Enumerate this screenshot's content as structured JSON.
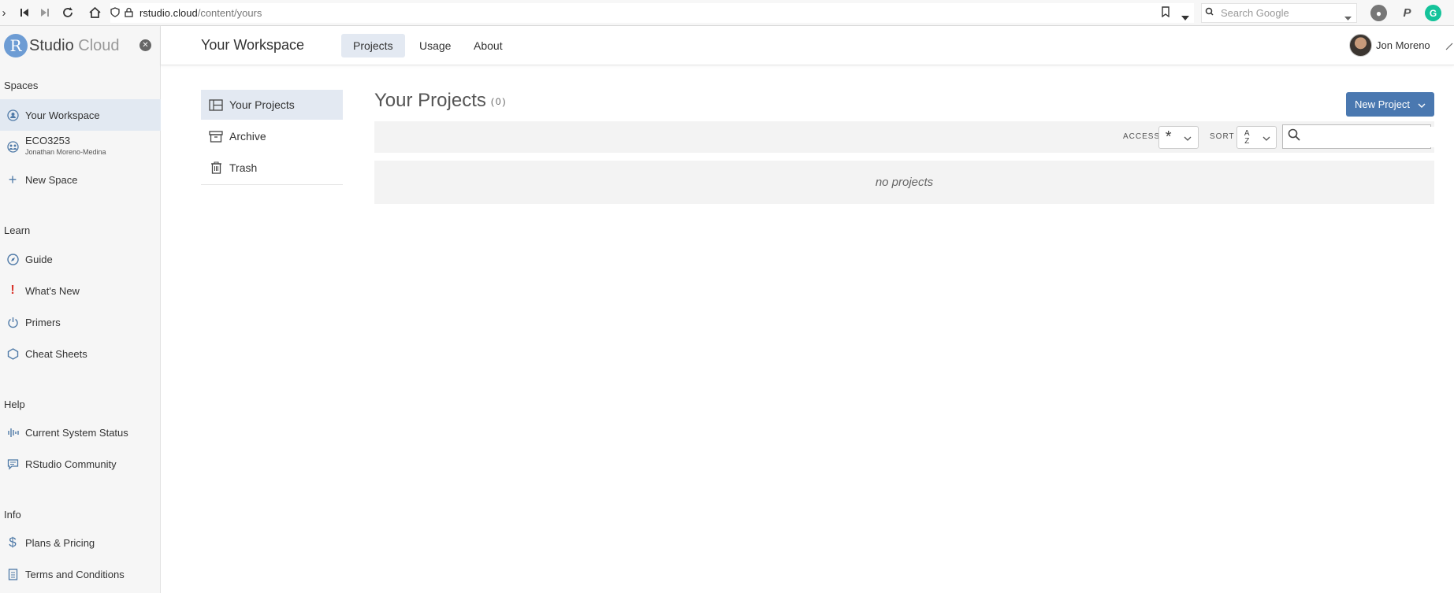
{
  "browser": {
    "url_host": "rstudio.cloud",
    "url_path": "/content/yours",
    "search_placeholder": "Search Google"
  },
  "sidebar": {
    "brand_letter": "R",
    "brand_main": "Studio",
    "brand_light": "Cloud",
    "sections": {
      "spaces": "Spaces",
      "learn": "Learn",
      "help": "Help",
      "info": "Info"
    },
    "spaces": [
      {
        "label": "Your Workspace",
        "icon": "workspace-icon"
      },
      {
        "label": "ECO3253",
        "sub": "Jonathan Moreno-Medina",
        "icon": "group-icon"
      },
      {
        "label": "New Space",
        "icon": "plus-icon"
      }
    ],
    "learn": [
      {
        "label": "Guide",
        "icon": "compass-icon"
      },
      {
        "label": "What's New",
        "icon": "exclamation-icon"
      },
      {
        "label": "Primers",
        "icon": "power-icon"
      },
      {
        "label": "Cheat Sheets",
        "icon": "hexagon-icon"
      }
    ],
    "help": [
      {
        "label": "Current System Status",
        "icon": "pulse-icon"
      },
      {
        "label": "RStudio Community",
        "icon": "chat-icon"
      }
    ],
    "info": [
      {
        "label": "Plans & Pricing",
        "icon": "dollar-icon"
      },
      {
        "label": "Terms and Conditions",
        "icon": "document-icon"
      }
    ]
  },
  "header": {
    "title": "Your Workspace",
    "tabs": [
      "Projects",
      "Usage",
      "About"
    ],
    "user_name": "Jon Moreno"
  },
  "content_nav": [
    "Your Projects",
    "Archive",
    "Trash"
  ],
  "main": {
    "title": "Your Projects",
    "count": "(0)",
    "new_button": "New Project",
    "access_label": "ACCESS",
    "access_value": "*",
    "sort_label": "SORT",
    "sort_value": "A Z",
    "empty_text": "no projects"
  },
  "colors": {
    "accent": "#4a78b0",
    "active_bg": "#e3e9f2",
    "sidebar_bg": "#f6f6f6"
  }
}
